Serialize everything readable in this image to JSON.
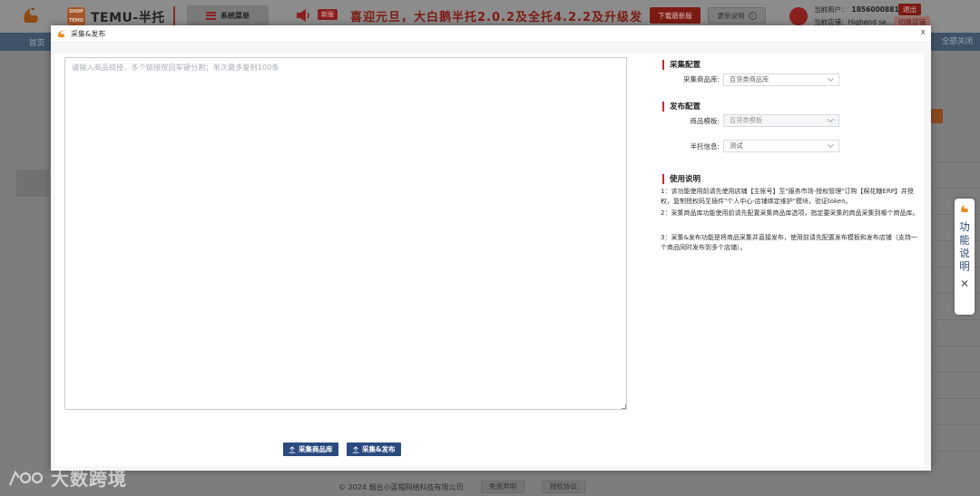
{
  "header": {
    "app_title": "TEMU-半托",
    "temu_logo_text": "SHOP TEMU",
    "system_menu_label": "系统菜单",
    "new_badge": "新版",
    "announcement": "喜迎元旦，大白鹅半托2.0.2及全托4.2.2及升级发",
    "download_label": "下载最新版",
    "changelog_label": "更新说明",
    "user_label": "当前用户：",
    "user_value": "18560008818",
    "store_label": "当前店铺：Highend se...",
    "logout_label": "退出",
    "switch_store_label": "切换店铺"
  },
  "nav": {
    "home": "首页",
    "close_all": "全部关闭"
  },
  "footer": {
    "copyright": "© 2024 烟台小蓝帽网络科技有限公司",
    "disclaimer": "免责声明",
    "license": "授权协议"
  },
  "watermark": {
    "text": "大数跨境"
  },
  "feature_panel": {
    "label": "功能说明"
  },
  "modal": {
    "title": "采集&发布",
    "close": "x",
    "input_placeholder": "请输入商品链接，多个链接按回车键分割；单次最多复制100条",
    "collect_button": "采集商品库",
    "collect_publish_button": "采集&发布",
    "collect_config": {
      "title": "采集配置",
      "library_label": "采集商品库:",
      "library_value": "百货类商品库"
    },
    "publish_config": {
      "title": "发布配置",
      "template_label": "商品模板:",
      "template_value": "百货类模板",
      "info_label": "半托信息:",
      "info_value": "测试"
    },
    "instructions": {
      "title": "使用说明",
      "items": [
        "1：该功能使用前请先使用店铺【主账号】至\"服务市场-授权管理\"订购【棉花糖ERP】并授权，复制授权码至插件\"个人中心-店铺绑定维护\"模块，验证token。",
        "2：采集商品库功能使用前请先配置采集商品库选项，指定要采集的商品采集到哪个商品库。",
        "3：采集&发布功能是将商品采集并直接发布，使用前请先配置发布模板和发布店铺（支持一个商品同时发布到多个店铺）。"
      ]
    }
  },
  "colors": {
    "accent_blue": "#2b4a80",
    "section_red": "#d8252b",
    "header_red": "#7d1b13"
  }
}
